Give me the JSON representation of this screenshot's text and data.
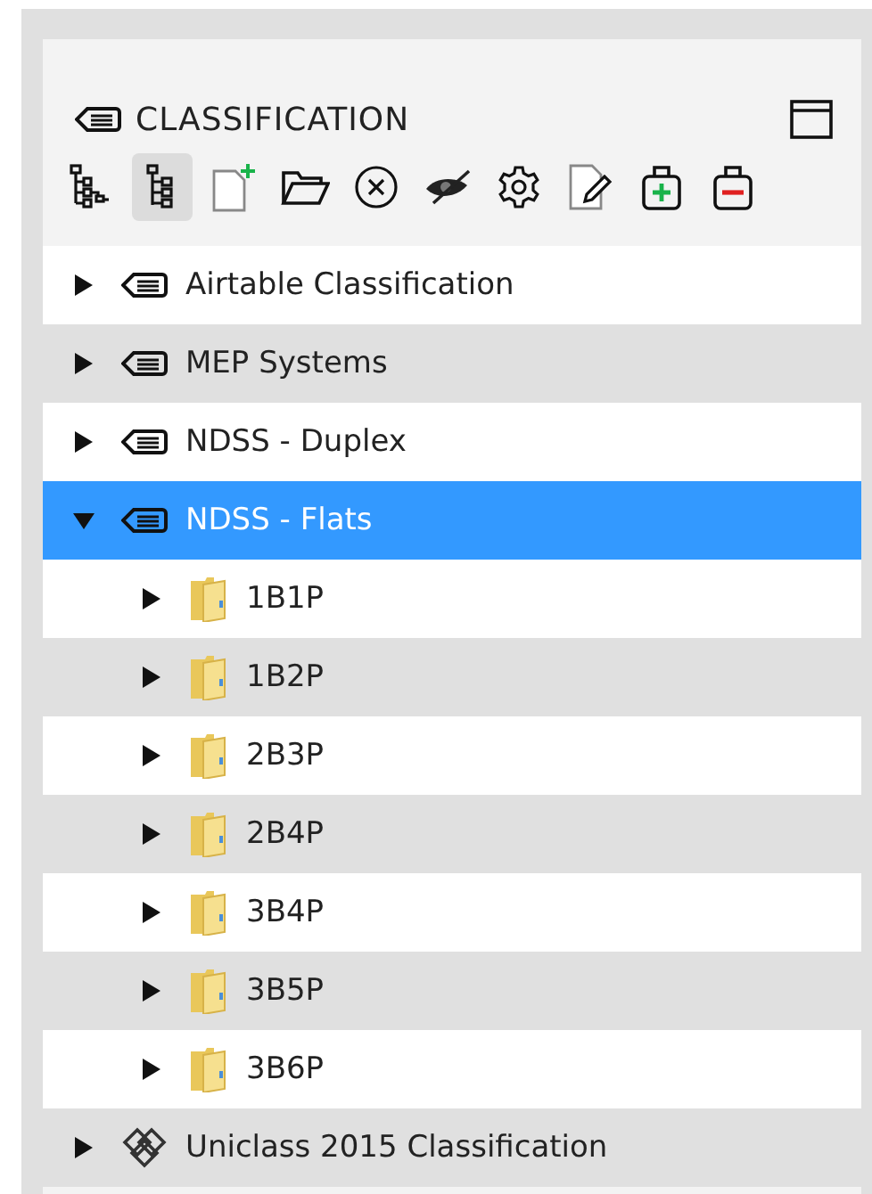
{
  "panel": {
    "title": "CLASSIFICATION"
  },
  "toolbar": [
    {
      "kind": "tree-branch",
      "selected": false
    },
    {
      "kind": "tree-list",
      "selected": true
    },
    {
      "kind": "new-file",
      "selected": false
    },
    {
      "kind": "open-folder",
      "selected": false
    },
    {
      "kind": "circle-x",
      "selected": false
    },
    {
      "kind": "hide",
      "selected": false
    },
    {
      "kind": "gear",
      "selected": false
    },
    {
      "kind": "edit-file",
      "selected": false
    },
    {
      "kind": "bag-plus",
      "selected": false
    },
    {
      "kind": "bag-minus",
      "selected": false
    }
  ],
  "tree": [
    {
      "label": "Airtable Classification",
      "kind": "classification",
      "expanded": false,
      "selected": false
    },
    {
      "label": "MEP Systems",
      "kind": "classification",
      "expanded": false,
      "selected": false
    },
    {
      "label": "NDSS - Duplex",
      "kind": "classification",
      "expanded": false,
      "selected": false
    },
    {
      "label": "NDSS - Flats",
      "kind": "classification",
      "expanded": true,
      "selected": true,
      "children": [
        {
          "label": "1B1P",
          "kind": "folder",
          "expanded": false,
          "selected": false
        },
        {
          "label": "1B2P",
          "kind": "folder",
          "expanded": false,
          "selected": false
        },
        {
          "label": "2B3P",
          "kind": "folder",
          "expanded": false,
          "selected": false
        },
        {
          "label": "2B4P",
          "kind": "folder",
          "expanded": false,
          "selected": false
        },
        {
          "label": "3B4P",
          "kind": "folder",
          "expanded": false,
          "selected": false
        },
        {
          "label": "3B5P",
          "kind": "folder",
          "expanded": false,
          "selected": false
        },
        {
          "label": "3B6P",
          "kind": "folder",
          "expanded": false,
          "selected": false
        }
      ]
    },
    {
      "label": "Uniclass 2015 Classification",
      "kind": "uniclass",
      "expanded": false,
      "selected": false
    }
  ]
}
